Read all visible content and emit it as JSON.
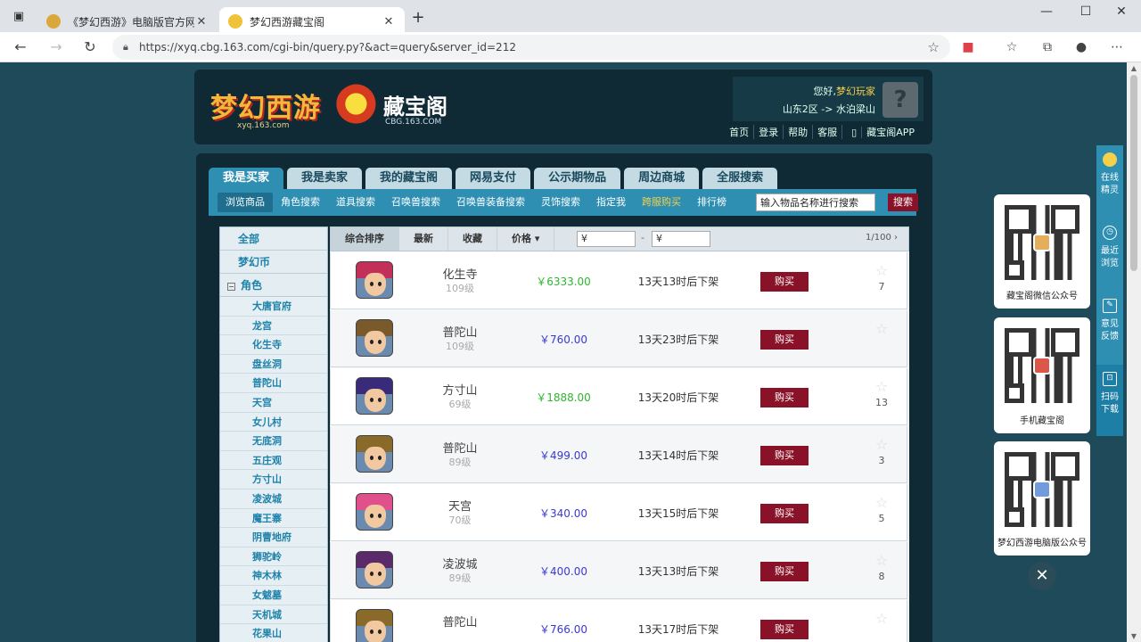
{
  "browser": {
    "tabs": [
      {
        "title": "《梦幻西游》电脑版官方网站 - 网",
        "active": false
      },
      {
        "title": "梦幻西游藏宝阁",
        "active": true
      }
    ],
    "url": "https://xyq.cbg.163.com/cgi-bin/query.py?&act=query&server_id=212"
  },
  "header": {
    "game_logo": "梦幻西游",
    "game_logo_sub": "xyq.163.com",
    "cbg_logo": "藏宝阁",
    "cbg_logo_sub": "CBG.163.COM",
    "greeting": "您好,",
    "username": "梦幻玩家",
    "server_path": "山东2区 -> 水泊梁山",
    "links": [
      "首页",
      "登录",
      "帮助",
      "客服",
      "藏宝阁APP"
    ]
  },
  "main_tabs": [
    "我是买家",
    "我是卖家",
    "我的藏宝阁",
    "网易支付",
    "公示期物品",
    "周边商城",
    "全服搜索"
  ],
  "sub_nav": [
    "浏览商品",
    "角色搜索",
    "道具搜索",
    "召唤兽搜索",
    "召唤兽装备搜索",
    "灵饰搜索",
    "指定我",
    "跨服购买",
    "排行榜"
  ],
  "search": {
    "placeholder": "输入物品名称进行搜索",
    "button": "搜索"
  },
  "sidebar": {
    "top": [
      "全部",
      "梦幻币"
    ],
    "role": "角色",
    "schools": [
      "大唐官府",
      "龙宫",
      "化生寺",
      "盘丝洞",
      "普陀山",
      "天宫",
      "女儿村",
      "无底洞",
      "五庄观",
      "方寸山",
      "凌波城",
      "魔王寨",
      "阴曹地府",
      "狮驼岭",
      "神木林",
      "女魃墓",
      "天机城",
      "花果山"
    ]
  },
  "sort_bar": {
    "options": [
      "综合排序",
      "最新",
      "收藏",
      "价格"
    ],
    "price_symbol": "¥",
    "dash": "-",
    "pager": "1/100"
  },
  "listings": [
    {
      "school": "化生寺",
      "level": "109级",
      "price": "￥6333.00",
      "price_color": "#2fb52f",
      "time": "13天13时后下架",
      "buy": "购买",
      "favs": "7",
      "hair": "#c2305a"
    },
    {
      "school": "普陀山",
      "level": "109级",
      "price": "￥760.00",
      "price_color": "#3a3ad0",
      "time": "13天23时后下架",
      "buy": "购买",
      "favs": "",
      "hair": "#7a5a2a"
    },
    {
      "school": "方寸山",
      "level": "69级",
      "price": "￥1888.00",
      "price_color": "#2fb52f",
      "time": "13天20时后下架",
      "buy": "购买",
      "favs": "13",
      "hair": "#3a2a7a"
    },
    {
      "school": "普陀山",
      "level": "89级",
      "price": "￥499.00",
      "price_color": "#3a3ad0",
      "time": "13天14时后下架",
      "buy": "购买",
      "favs": "3",
      "hair": "#8a6a2a"
    },
    {
      "school": "天宫",
      "level": "70级",
      "price": "￥340.00",
      "price_color": "#3a3ad0",
      "time": "13天15时后下架",
      "buy": "购买",
      "favs": "5",
      "hair": "#e0508a"
    },
    {
      "school": "凌波城",
      "level": "89级",
      "price": "￥400.00",
      "price_color": "#3a3ad0",
      "time": "13天13时后下架",
      "buy": "购买",
      "favs": "8",
      "hair": "#5a2a6a"
    },
    {
      "school": "普陀山",
      "level": "",
      "price": "￥766.00",
      "price_color": "#3a3ad0",
      "time": "13天17时后下架",
      "buy": "购买",
      "favs": "",
      "hair": "#8a6a2a"
    }
  ],
  "qr_cards": [
    "藏宝阁微信公众号",
    "手机藏宝阁",
    "梦幻西游电脑版公众号"
  ],
  "side_panel": [
    {
      "label1": "在线",
      "label2": "精灵"
    },
    {
      "label1": "最近",
      "label2": "浏览"
    },
    {
      "label1": "意见",
      "label2": "反馈"
    },
    {
      "label1": "扫码",
      "label2": "下载"
    }
  ],
  "colors": {
    "accent": "#2e8fb3",
    "buy": "#8a1228",
    "page_bg": "#1f4a5a"
  }
}
